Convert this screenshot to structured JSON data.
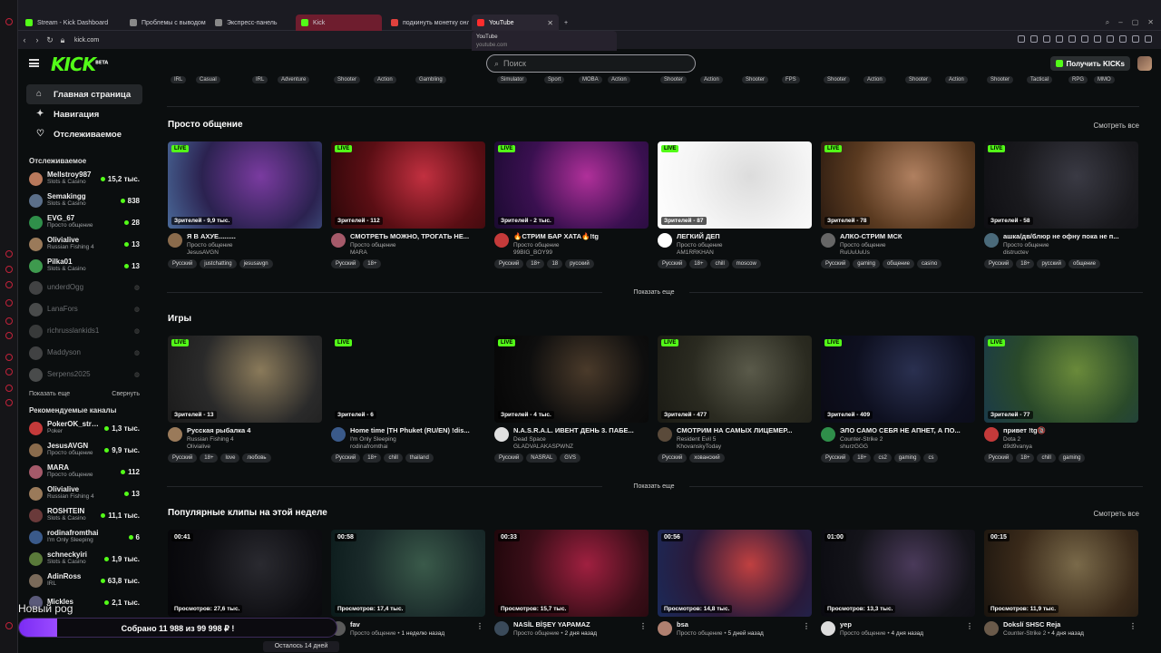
{
  "browser": {
    "tabs": [
      {
        "title": "Stream - Kick Dashboard",
        "color": "#53fc18"
      },
      {
        "title": "Проблемы с выводом с",
        "color": "#888888"
      },
      {
        "title": "Экспресс-панель",
        "color": "#888888"
      },
      {
        "title": "Kick",
        "color": "#53fc18"
      },
      {
        "title": "подкинуть монетку онл",
        "color": "#e0413d"
      },
      {
        "title": "YouTube",
        "color": "#ff2d2d"
      }
    ],
    "url": "kick.com",
    "tooltip": {
      "title": "YouTube",
      "url": "youtube.com"
    }
  },
  "header": {
    "logo": "KICK",
    "logo_badge": "BETA",
    "search_placeholder": "Поиск",
    "get_kicks": "Получить KICKs"
  },
  "sidebar": {
    "nav": [
      {
        "label": "Главная страница",
        "icon": "home-icon",
        "active": true
      },
      {
        "label": "Навигация",
        "icon": "compass-icon",
        "active": false
      },
      {
        "label": "Отслеживаемое",
        "icon": "heart-icon",
        "active": false
      }
    ],
    "followed_title": "Отслеживаемое",
    "followed": [
      {
        "name": "Mellstroy987",
        "category": "Slots & Casino",
        "viewers": "15,2 тыс.",
        "online": true,
        "color": "#b8795c"
      },
      {
        "name": "Semakingg",
        "category": "Slots & Casino",
        "viewers": "838",
        "online": true,
        "color": "#5b6f8a"
      },
      {
        "name": "EVG_67",
        "category": "Просто общение",
        "viewers": "28",
        "online": true,
        "color": "#2f8f4a"
      },
      {
        "name": "Olivialive",
        "category": "Russian Fishing 4",
        "viewers": "13",
        "online": true,
        "color": "#9a7a5a"
      },
      {
        "name": "Pilka01",
        "category": "Slots & Casino",
        "viewers": "13",
        "online": true,
        "color": "#3e9a4e"
      },
      {
        "name": "underdOgg",
        "category": "",
        "viewers": "",
        "online": false,
        "color": "#777777"
      },
      {
        "name": "LanaFors",
        "category": "",
        "viewers": "",
        "online": false,
        "color": "#888888"
      },
      {
        "name": "richrusslankids1",
        "category": "",
        "viewers": "",
        "online": false,
        "color": "#666666"
      },
      {
        "name": "Maddyson",
        "category": "",
        "viewers": "",
        "online": false,
        "color": "#777777"
      },
      {
        "name": "Serpens2025",
        "category": "",
        "viewers": "",
        "online": false,
        "color": "#888888"
      }
    ],
    "show_more": "Показать еще",
    "collapse": "Свернуть",
    "recommended_title": "Рекомендуемые каналы",
    "recommended": [
      {
        "name": "PokerOK_stre...",
        "category": "Poker",
        "viewers": "1,3 тыс.",
        "color": "#c43a3a"
      },
      {
        "name": "JesusAVGN",
        "category": "Просто общение",
        "viewers": "9,9 тыс.",
        "color": "#8a6b4c"
      },
      {
        "name": "MARA",
        "category": "Просто общение",
        "viewers": "112",
        "color": "#a55a6a"
      },
      {
        "name": "Olivialive",
        "category": "Russian Fishing 4",
        "viewers": "13",
        "color": "#9a7a5a"
      },
      {
        "name": "ROSHTEIN",
        "category": "Slots & Casino",
        "viewers": "11,1 тыс.",
        "color": "#6a3a3a"
      },
      {
        "name": "rodinafromthai",
        "category": "I'm Only Sleeping",
        "viewers": "6",
        "color": "#3a5a8a"
      },
      {
        "name": "schneckyiri",
        "category": "Slots & Casino",
        "viewers": "1,9 тыс.",
        "color": "#5a7a3a"
      },
      {
        "name": "AdinRoss",
        "category": "IRL",
        "viewers": "63,8 тыс.",
        "color": "#7a6a5a"
      },
      {
        "name": "Mickles",
        "category": "",
        "viewers": "2,1 тыс.",
        "color": "#5a5a7a"
      }
    ]
  },
  "top_tags": [
    [
      "IRL",
      "Casual"
    ],
    [
      "IRL",
      "Adventure"
    ],
    [
      "Shooter",
      "Action"
    ],
    [
      "Gambling"
    ],
    [
      "Simulator",
      "Sport"
    ],
    [
      "MOBA",
      "Action"
    ],
    [
      "Shooter",
      "Action"
    ],
    [
      "Shooter",
      "FPS"
    ],
    [
      "Shooter",
      "Action"
    ],
    [
      "Shooter",
      "Action"
    ],
    [
      "Shooter",
      "Tactical"
    ],
    [
      "RPG",
      "MMO"
    ]
  ],
  "sections": [
    {
      "title": "Просто общение",
      "see_all": "Смотреть все",
      "show_more": "Показать еще",
      "cards": [
        {
          "badge": "LIVE",
          "stat": "Зрителей - 9,9 тыс.",
          "title": "Я В АХУЕ.........",
          "category": "Просто общение",
          "user": "JesusAVGN",
          "tags": [
            "Русский",
            "justchatting",
            "jesusavgn"
          ],
          "thumb": [
            "#2b2250",
            "#7a3ba0",
            "#4a6a9a"
          ],
          "avatar": "#8a6b4c"
        },
        {
          "badge": "LIVE",
          "stat": "Зрителей - 112",
          "title": "СМОТРЕТЬ МОЖНО, ТРОГАТЬ НЕ...",
          "category": "Просто общение",
          "user": "MARA",
          "tags": [
            "Русский",
            "18+"
          ],
          "thumb": [
            "#5a0e14",
            "#c23040",
            "#2a0708"
          ],
          "avatar": "#a55a6a"
        },
        {
          "badge": "LIVE",
          "stat": "Зрителей - 2 тыс.",
          "title": "🔥СТРИМ БАР ХАТА🔥!tg",
          "category": "Просто общение",
          "user": "99BIG_BOY99",
          "tags": [
            "Русский",
            "18+",
            "18",
            "русский"
          ],
          "thumb": [
            "#3a1050",
            "#b0309a",
            "#1a0a30"
          ],
          "avatar": "#c43a3a"
        },
        {
          "badge": "LIVE",
          "stat": "Зрителей - 87",
          "title": "ЛЕГКИЙ ДЕП",
          "category": "Просто общение",
          "user": "AM1RRKHAN",
          "tags": [
            "Русский",
            "18+",
            "chill",
            "moscow"
          ],
          "thumb": [
            "#f4f4f4",
            "#dcdcdc",
            "#ffffff"
          ],
          "avatar": "#ffffff"
        },
        {
          "badge": "LIVE",
          "stat": "Зрителей - 78",
          "title": "АЛКО-СТРИМ МСК",
          "category": "Просто общение",
          "user": "RuUuUuUs",
          "tags": [
            "Русский",
            "gaming",
            "общение",
            "casino"
          ],
          "thumb": [
            "#5a3a20",
            "#b08060",
            "#2a1a10"
          ],
          "avatar": "#666666"
        },
        {
          "badge": "LIVE",
          "stat": "Зрителей - 58",
          "title": "ашка/дв/блюр не офну пока не п...",
          "category": "Просто общение",
          "user": "distructev",
          "tags": [
            "Русский",
            "18+",
            "русский",
            "общение"
          ],
          "thumb": [
            "#1a1a1e",
            "#3a3a44",
            "#0e0e12"
          ],
          "avatar": "#4a6a7a"
        }
      ]
    },
    {
      "title": "Игры",
      "see_all": "",
      "show_more": "Показать еще",
      "cards": [
        {
          "badge": "LIVE",
          "stat": "Зрителей - 13",
          "title": "Русская рыбалка 4",
          "category": "Russian Fishing 4",
          "user": "Olivialive",
          "tags": [
            "Русский",
            "18+",
            "love",
            "любовь"
          ],
          "thumb": [
            "#2a2a2a",
            "#8a7a5a",
            "#1a1a1a"
          ],
          "avatar": "#9a7a5a"
        },
        {
          "badge": "LIVE",
          "stat": "Зрителей - 6",
          "title": "Home time |TH Phuket (RU/EN) !dis...",
          "category": "I'm Only Sleeping",
          "user": "rodinafromthai",
          "tags": [
            "Русский",
            "18+",
            "chill",
            "thailand"
          ],
          "thumb": [
            "#0b0e0f",
            "#0b0e0f",
            "#0b0e0f"
          ],
          "avatar": "#3a5a8a"
        },
        {
          "badge": "LIVE",
          "stat": "Зрителей - 4 тыс.",
          "title": "N.A.S.R.A.L. ИВЕНТ ДЕНЬ 3. ПАБЕ...",
          "category": "Dead Space",
          "user": "GLADVALAKASPWNZ",
          "tags": [
            "Русский",
            "NASRAL",
            "GVS"
          ],
          "thumb": [
            "#0e0e0e",
            "#4a3a2a",
            "#050505"
          ],
          "avatar": "#e0e0e0"
        },
        {
          "badge": "LIVE",
          "stat": "Зрителей - 477",
          "title": "СМОТРИМ НА САМЫХ ЛИЦЕМЕР...",
          "category": "Resident Evil 5",
          "user": "KhovanskyToday",
          "tags": [
            "Русский",
            "хованский"
          ],
          "thumb": [
            "#2a2a20",
            "#5a5a4a",
            "#1a1a14"
          ],
          "avatar": "#5a4a3a"
        },
        {
          "badge": "LIVE",
          "stat": "Зрителей - 409",
          "title": "ЭЛО САМО СЕБЯ НЕ АПНЕТ, А ПО...",
          "category": "Counter-Strike 2",
          "user": "shurzGGG",
          "tags": [
            "Русский",
            "18+",
            "cs2",
            "gaming",
            "cs"
          ],
          "thumb": [
            "#0e1020",
            "#2a3050",
            "#0a0a14"
          ],
          "avatar": "#2f8f4a"
        },
        {
          "badge": "LIVE",
          "stat": "Зрителей - 77",
          "title": "привет !tg🔞",
          "category": "Dota 2",
          "user": "d9d9vanya",
          "tags": [
            "Русский",
            "18+",
            "chill",
            "gaming"
          ],
          "thumb": [
            "#2a4a2a",
            "#6a8a3a",
            "#1a3a4a"
          ],
          "avatar": "#c43a3a"
        }
      ]
    },
    {
      "title": "Популярные клипы на этой неделе",
      "see_all": "Смотреть все",
      "show_more": "",
      "cards": [
        {
          "badge": "00:41",
          "stat": "Просмотров: 27,6 тыс.",
          "title": "",
          "category": "",
          "user": "",
          "tags": [],
          "thumb": [
            "#0e0e12",
            "#2a2a30",
            "#050508"
          ],
          "avatar": "#5a5a5a"
        },
        {
          "badge": "00:58",
          "stat": "Просмотров: 17,4 тыс.",
          "title": "fav",
          "category": "Просто общение",
          "user": "1 неделю назад",
          "tags": [],
          "thumb": [
            "#1a2a2a",
            "#3a5a4a",
            "#0a1a1a"
          ],
          "avatar": "#5a5a5a"
        },
        {
          "badge": "00:33",
          "stat": "Просмотров: 15,7 тыс.",
          "title": "NASİL BİŞEY YAPAMAZ",
          "category": "Просто общение",
          "user": "2 дня назад",
          "tags": [],
          "thumb": [
            "#3a0e18",
            "#a02040",
            "#1a0508"
          ],
          "avatar": "#3a4a5a"
        },
        {
          "badge": "00:56",
          "stat": "Просмотров: 14,8 тыс.",
          "title": "bsa",
          "category": "Просто общение",
          "user": "5 дней назад",
          "tags": [],
          "thumb": [
            "#2a1a3a",
            "#c04040",
            "#1a2a5a"
          ],
          "avatar": "#b08070"
        },
        {
          "badge": "01:00",
          "stat": "Просмотров: 13,3 тыс.",
          "title": "yep",
          "category": "Просто общение",
          "user": "4 дня назад",
          "tags": [],
          "thumb": [
            "#14141a",
            "#4a3a5a",
            "#0a0a10"
          ],
          "avatar": "#dddddd"
        },
        {
          "badge": "00:15",
          "stat": "Просмотров: 11,9 тыс.",
          "title": "Dokslí SHSC Reja",
          "category": "Counter-Strike 2",
          "user": "4 дня назад",
          "tags": [],
          "thumb": [
            "#3a2a1a",
            "#7a6a4a",
            "#1a140e"
          ],
          "avatar": "#6a5a4a"
        }
      ]
    }
  ],
  "clip_meta_sep": " • ",
  "overlay": {
    "goal_label": "Новый pog",
    "donation_text": "Собрано 11 988  из 99 998 ₽ !",
    "progress": 0.12,
    "remaining": "Осталось 14 дней"
  },
  "colors": {
    "accent": "#53fc18",
    "bg": "#0b0e0f"
  }
}
